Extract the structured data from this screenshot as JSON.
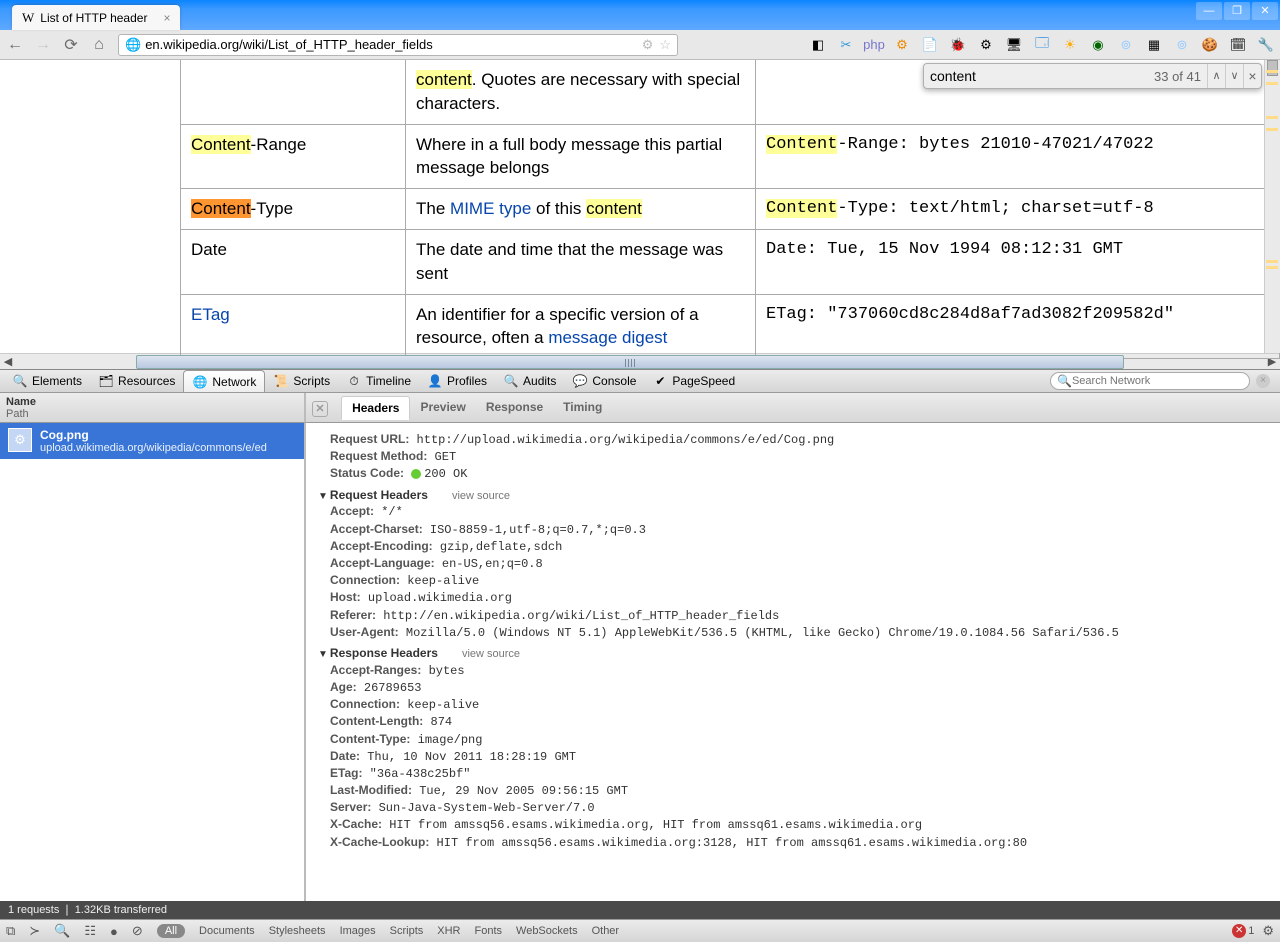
{
  "window": {
    "tab_title": "List of HTTP header",
    "min": "—",
    "max": "❐",
    "close": "✕"
  },
  "nav": {
    "url": "en.wikipedia.org/wiki/List_of_HTTP_header_fields"
  },
  "find": {
    "value": "content",
    "counter": "33 of 41"
  },
  "table": {
    "rows": [
      {
        "name_pre": "",
        "name_hi": "content",
        "name_hi_class": "hilite",
        "name_post": "",
        "desc_pre": "",
        "desc_hi": "",
        "desc_post": ". Quotes are necessary with special characters.",
        "ex_pre": "",
        "ex_hi": "",
        "ex_post": "",
        "partial_top": true
      },
      {
        "name_hi": "Content",
        "name_hi_class": "hilite",
        "name_post": "-Range",
        "desc": "Where in a full body message this partial message belongs",
        "ex_hi": "Content",
        "ex_post": "-Range: bytes 21010-47021/47022"
      },
      {
        "name_hi": "Content",
        "name_hi_class": "hilite current",
        "name_post": "-Type",
        "desc_pre": "The ",
        "desc_link": "MIME type",
        "desc_mid": " of this ",
        "desc_hi": "content",
        "ex_hi": "Content",
        "ex_post": "-Type: text/html; charset=utf-8"
      },
      {
        "name": "Date",
        "desc": "The date and time that the message was sent",
        "ex": "Date: Tue, 15 Nov 1994 08:12:31 GMT"
      },
      {
        "name_link": "ETag",
        "desc_pre": "An identifier for a specific version of a resource, often a ",
        "desc_link": "message digest",
        "ex": "ETag: \"737060cd8c284d8af7ad3082f209582d\""
      }
    ]
  },
  "devtools": {
    "tabs": [
      "Elements",
      "Resources",
      "Network",
      "Scripts",
      "Timeline",
      "Profiles",
      "Audits",
      "Console",
      "PageSpeed"
    ],
    "active_tab": "Network",
    "search_placeholder": "Search Network",
    "columns": {
      "name": "Name",
      "path": "Path"
    },
    "requests": [
      {
        "name": "Cog.png",
        "path": "upload.wikimedia.org/wikipedia/commons/e/ed"
      }
    ],
    "detail_tabs": [
      "Headers",
      "Preview",
      "Response",
      "Timing"
    ],
    "detail_active": "Headers",
    "request_url_label": "Request URL:",
    "request_url": "http://upload.wikimedia.org/wikipedia/commons/e/ed/Cog.png",
    "request_method_label": "Request Method:",
    "request_method": "GET",
    "status_code_label": "Status Code:",
    "status_code": "200 OK",
    "req_hdr_title": "Request Headers",
    "resp_hdr_title": "Response Headers",
    "view_source": "view source",
    "req_headers": [
      {
        "k": "Accept:",
        "v": "*/*"
      },
      {
        "k": "Accept-Charset:",
        "v": "ISO-8859-1,utf-8;q=0.7,*;q=0.3"
      },
      {
        "k": "Accept-Encoding:",
        "v": "gzip,deflate,sdch"
      },
      {
        "k": "Accept-Language:",
        "v": "en-US,en;q=0.8"
      },
      {
        "k": "Connection:",
        "v": "keep-alive"
      },
      {
        "k": "Host:",
        "v": "upload.wikimedia.org"
      },
      {
        "k": "Referer:",
        "v": "http://en.wikipedia.org/wiki/List_of_HTTP_header_fields"
      },
      {
        "k": "User-Agent:",
        "v": "Mozilla/5.0 (Windows NT 5.1) AppleWebKit/536.5 (KHTML, like Gecko) Chrome/19.0.1084.56 Safari/536.5"
      }
    ],
    "resp_headers": [
      {
        "k": "Accept-Ranges:",
        "v": "bytes"
      },
      {
        "k": "Age:",
        "v": "26789653"
      },
      {
        "k": "Connection:",
        "v": "keep-alive"
      },
      {
        "k": "Content-Length:",
        "v": "874"
      },
      {
        "k": "Content-Type:",
        "v": "image/png"
      },
      {
        "k": "Date:",
        "v": "Thu, 10 Nov 2011 18:28:19 GMT"
      },
      {
        "k": "ETag:",
        "v": "\"36a-438c25bf\""
      },
      {
        "k": "Last-Modified:",
        "v": "Tue, 29 Nov 2005 09:56:15 GMT"
      },
      {
        "k": "Server:",
        "v": "Sun-Java-System-Web-Server/7.0"
      },
      {
        "k": "X-Cache:",
        "v": "HIT from amssq56.esams.wikimedia.org, HIT from amssq61.esams.wikimedia.org"
      },
      {
        "k": "X-Cache-Lookup:",
        "v": "HIT from amssq56.esams.wikimedia.org:3128, HIT from amssq61.esams.wikimedia.org:80"
      }
    ],
    "footer1": "1 requests  ❘  1.32KB transferred",
    "filters": [
      "All",
      "Documents",
      "Stylesheets",
      "Images",
      "Scripts",
      "XHR",
      "Fonts",
      "WebSockets",
      "Other"
    ],
    "filter_active": "All",
    "error_count": "1"
  }
}
